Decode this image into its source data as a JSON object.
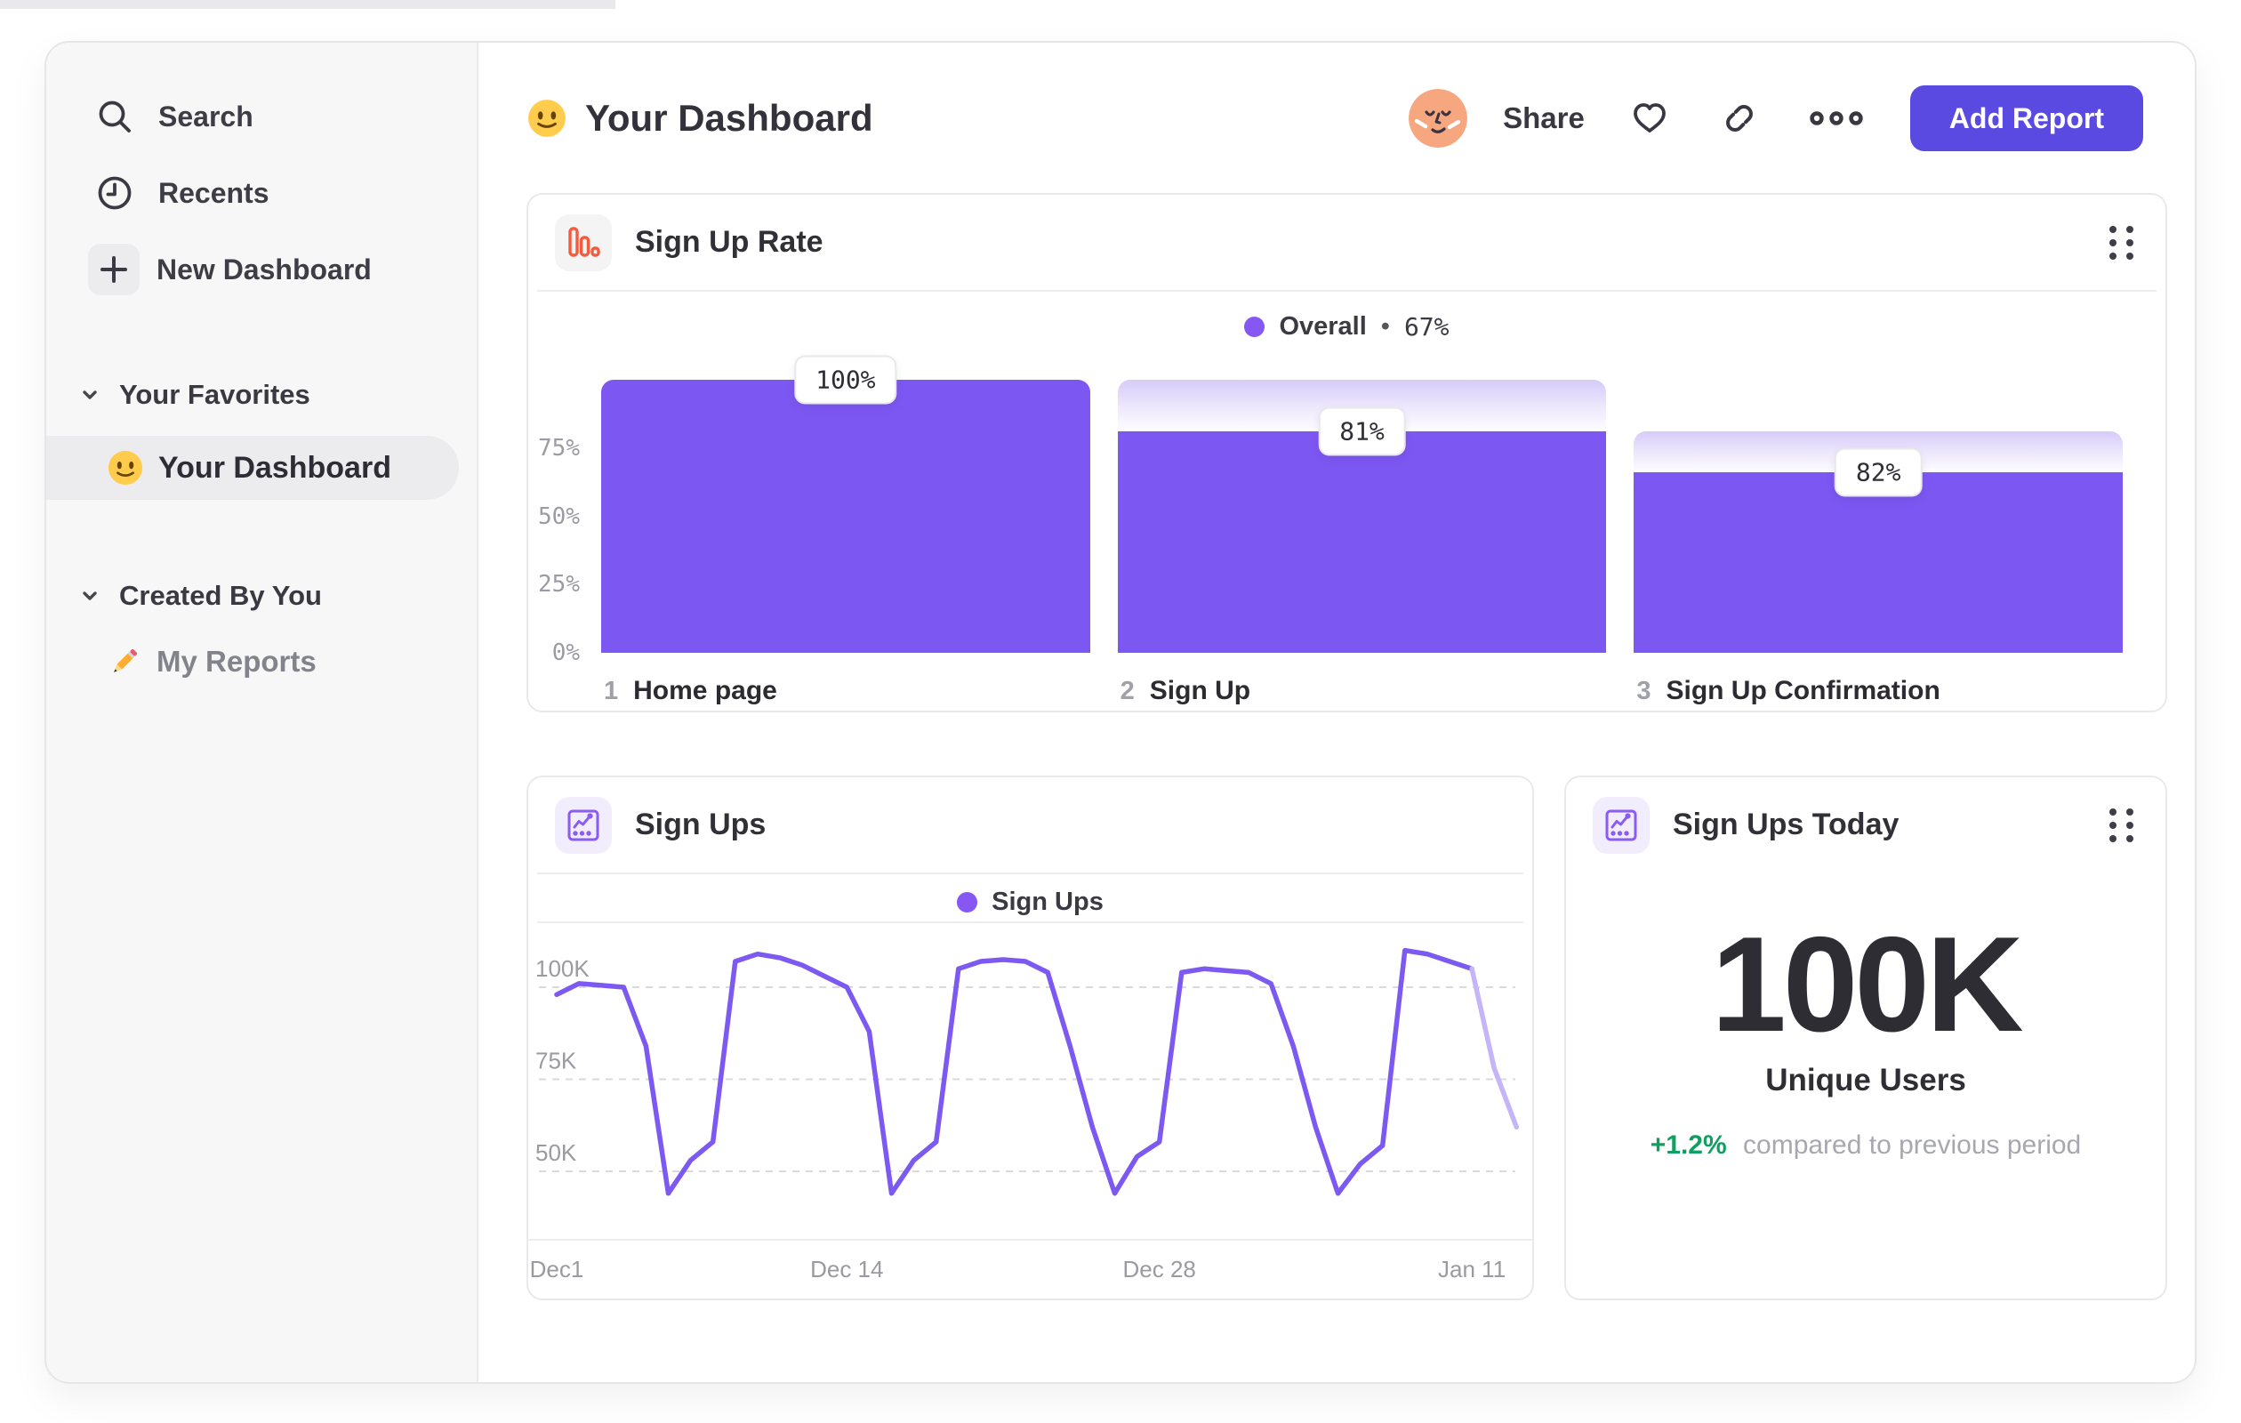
{
  "colors": {
    "accent_purple": "#7C59F1",
    "bar_purple": "#7D57F2",
    "legend_dot": "#8657F3",
    "button_purple": "#5B4AE1",
    "green": "#0FA061",
    "icon_orange": "#F25B3D",
    "icon_purple": "#8A5CF3",
    "faded_line": "#C4B5F8",
    "grid_gray": "#DADADE"
  },
  "sidebar": {
    "items": [
      {
        "icon": "search-icon",
        "label": "Search"
      },
      {
        "icon": "clock-icon",
        "label": "Recents"
      },
      {
        "icon": "plus-icon",
        "label": "New Dashboard"
      }
    ],
    "sections": [
      {
        "label": "Your Favorites",
        "items": [
          {
            "icon": "smiley-emoji",
            "label": "Your Dashboard",
            "active": true
          }
        ]
      },
      {
        "label": "Created By You",
        "items": [
          {
            "icon": "pencil-emoji",
            "label": "My Reports",
            "active": false
          }
        ]
      }
    ]
  },
  "header": {
    "icon": "smiley-emoji",
    "title": "Your Dashboard",
    "share_label": "Share",
    "add_report_label": "Add Report"
  },
  "chart_data": [
    {
      "type": "bar",
      "card_title": "Sign Up Rate",
      "icon": "bar-chart-icon",
      "legend": {
        "series": "Overall",
        "separator": "•",
        "overall_value": "67%"
      },
      "step_numbers": [
        "1",
        "2",
        "3"
      ],
      "categories": [
        "Home page",
        "Sign Up",
        "Sign Up Confirmation"
      ],
      "value_labels": [
        "100%",
        "81%",
        "82%"
      ],
      "bar_heights_pct": [
        100,
        81,
        66
      ],
      "ghost_top_pct": [
        null,
        100,
        81
      ],
      "yticks": [
        {
          "label": "75%",
          "value": 75
        },
        {
          "label": "50%",
          "value": 50
        },
        {
          "label": "25%",
          "value": 25
        },
        {
          "label": "0%",
          "value": 0
        }
      ],
      "ylim": [
        0,
        100
      ]
    },
    {
      "type": "line",
      "card_title": "Sign Ups",
      "icon": "line-chart-icon",
      "legend": {
        "series": "Sign Ups"
      },
      "x_tick_labels": [
        "Dec1",
        "Dec 14",
        "Dec 28",
        "Jan 11"
      ],
      "x_tick_days": [
        0,
        13,
        27,
        41
      ],
      "unit": "thousands of daily sign ups",
      "values": [
        98,
        101,
        100.5,
        100,
        84,
        44,
        53,
        58,
        107,
        109,
        108,
        106,
        103,
        100,
        88,
        44,
        53,
        58,
        105,
        107,
        107.5,
        107,
        104,
        84,
        62,
        44,
        54,
        58,
        104,
        105,
        104.5,
        104,
        101,
        84,
        62,
        44,
        52,
        57,
        110,
        109,
        107,
        105,
        78,
        62
      ],
      "faded_from_index": 41,
      "yticks": [
        {
          "label": "100K",
          "value": 100
        },
        {
          "label": "75K",
          "value": 75
        },
        {
          "label": "50K",
          "value": 50
        }
      ]
    },
    {
      "type": "big-number",
      "card_title": "Sign Ups Today",
      "icon": "line-chart-icon",
      "value": "100K",
      "value_label": "Unique Users",
      "delta": "+1.2%",
      "delta_note": "compared to previous period"
    }
  ]
}
